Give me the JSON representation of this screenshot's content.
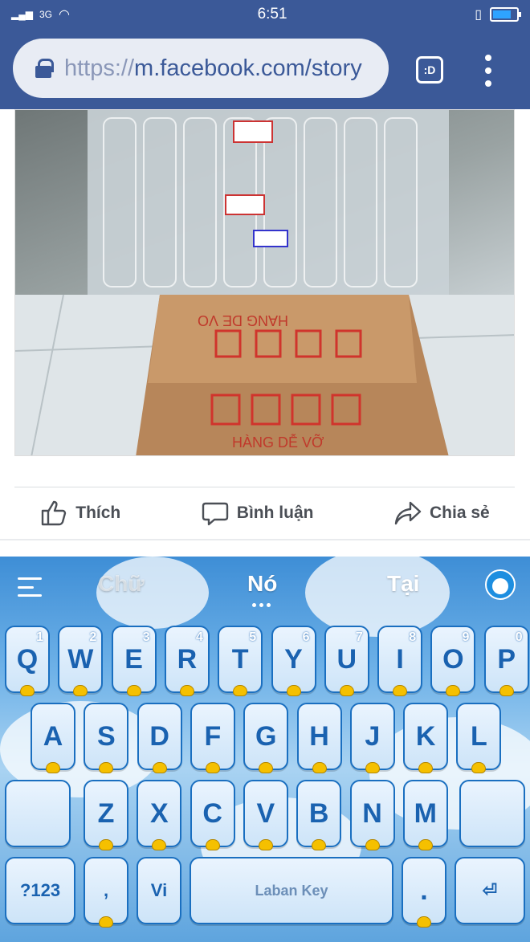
{
  "status_bar": {
    "signal_text": "3G",
    "time": "6:51",
    "battery_level": 0.8
  },
  "browser": {
    "url_scheme": "https://",
    "url_host": "m.facebook.com/story",
    "tab_label": ":D"
  },
  "post": {
    "image_icon": "photo-of-glass-bottles-and-box",
    "actions": {
      "like": "Thích",
      "comment": "Bình luận",
      "share": "Chia sẻ"
    }
  },
  "keyboard": {
    "suggestions": [
      "Chữ",
      "Nó",
      "Tại"
    ],
    "row1": [
      {
        "k": "Q",
        "n": "1"
      },
      {
        "k": "W",
        "n": "2"
      },
      {
        "k": "E",
        "n": "3"
      },
      {
        "k": "R",
        "n": "4"
      },
      {
        "k": "T",
        "n": "5"
      },
      {
        "k": "Y",
        "n": "6"
      },
      {
        "k": "U",
        "n": "7"
      },
      {
        "k": "I",
        "n": "8"
      },
      {
        "k": "O",
        "n": "9"
      },
      {
        "k": "P",
        "n": "0"
      }
    ],
    "row2": [
      "A",
      "S",
      "D",
      "F",
      "G",
      "H",
      "J",
      "K",
      "L"
    ],
    "row3": [
      "Z",
      "X",
      "C",
      "V",
      "B",
      "N",
      "M"
    ],
    "bottom": {
      "symbols": "?123",
      "comma_mic": ",",
      "lang": "Vi",
      "space": "Laban Key",
      "period": "."
    }
  }
}
